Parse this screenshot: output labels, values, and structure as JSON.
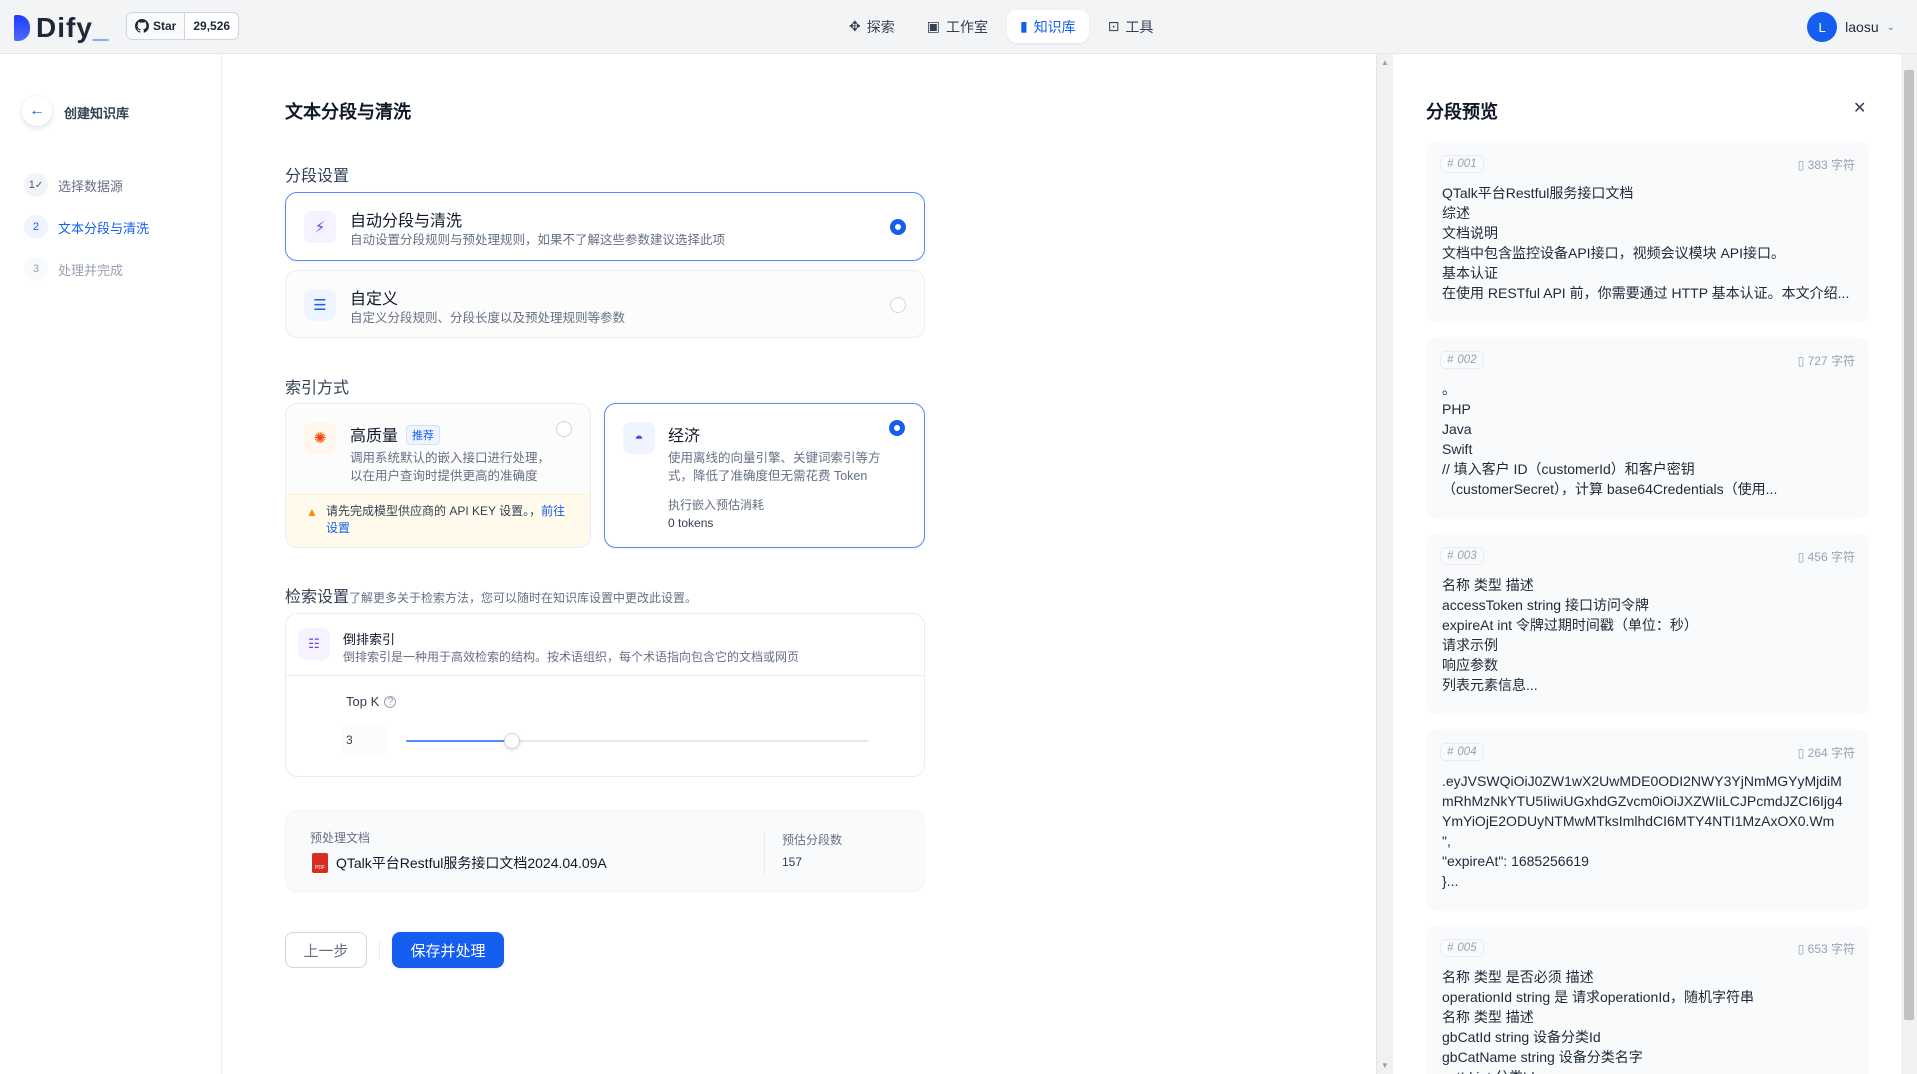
{
  "header": {
    "logo_text": "Dify",
    "github_star_label": "Star",
    "github_star_count": "29,526",
    "nav": [
      {
        "label": "探索",
        "icon": "explore-icon"
      },
      {
        "label": "工作室",
        "icon": "studio-icon"
      },
      {
        "label": "知识库",
        "icon": "knowledge-icon"
      },
      {
        "label": "工具",
        "icon": "tools-icon"
      }
    ],
    "active_nav": "知识库",
    "user": {
      "initial": "L",
      "name": "laosu"
    }
  },
  "sidebar": {
    "title": "创建知识库",
    "steps": [
      {
        "num": "1",
        "label": "选择数据源",
        "state": "done"
      },
      {
        "num": "2",
        "label": "文本分段与清洗",
        "state": "active"
      },
      {
        "num": "3",
        "label": "处理并完成",
        "state": "todo"
      }
    ]
  },
  "main": {
    "title": "文本分段与清洗",
    "segment_settings_label": "分段设置",
    "segment_modes": [
      {
        "title": "自动分段与清洗",
        "desc": "自动设置分段规则与预处理规则，如果不了解这些参数建议选择此项",
        "selected": true
      },
      {
        "title": "自定义",
        "desc": "自定义分段规则、分段长度以及预处理规则等参数",
        "selected": false
      }
    ],
    "index_label": "索引方式",
    "index_modes": {
      "high_quality": {
        "title": "高质量",
        "badge": "推荐",
        "desc_line1": "调用系统默认的嵌入接口进行处理，",
        "desc_line2": "以在用户查询时提供更高的准确度",
        "warning_text": "请先完成模型供应商的 API KEY 设置。",
        "warning_link_1": "前往",
        "warning_link_2": "设置",
        "selected": false
      },
      "economy": {
        "title": "经济",
        "desc_line1": "使用离线的向量引擎、关键词索引等方",
        "desc_line2": "式，降低了准确度但无需花费 Token",
        "cost_label": "执行嵌入预估消耗",
        "cost_value": "0 tokens",
        "selected": true
      }
    },
    "retrieval": {
      "title": "检索设置",
      "learn_more": "了解更多",
      "hint": "关于检索方法，您可以随时在知识库设置中更改此设置。",
      "method_title": "倒排索引",
      "method_desc": "倒排索引是一种用于高效检索的结构。按术语组织，每个术语指向包含它的文档或网页",
      "topk_label": "Top K",
      "topk_value": "3",
      "topk_fraction": 0.23
    },
    "summary": {
      "doc_label": "预处理文档",
      "doc_name": "QTalk平台Restful服务接口文档2024.04.09A",
      "seg_count_label": "预估分段数",
      "seg_count": "157"
    },
    "prev_button": "上一步",
    "save_button": "保存并处理"
  },
  "preview": {
    "title": "分段预览",
    "segments": [
      {
        "id": "001",
        "count": "383 字符",
        "lines": [
          "QTalk平台Restful服务接口文档",
          "综述",
          "文档说明",
          "文档中包含监控设备API接口，视频会议模块 API接口。",
          "基本认证",
          "在使用 RESTful API 前，你需要通过 HTTP 基本认证。本文介绍..."
        ]
      },
      {
        "id": "002",
        "count": "727 字符",
        "lines": [
          "。",
          "PHP",
          "Java",
          "Swift",
          "// 填入客户 ID（customerId）和客户密钥",
          "（customerSecret），计算 base64Credentials（使用..."
        ]
      },
      {
        "id": "003",
        "count": "456 字符",
        "lines": [
          "名称 类型 描述",
          "accessToken string 接口访问令牌",
          "expireAt int 令牌过期时间戳（单位：秒）",
          "请求示例",
          "响应参数",
          "列表元素信息..."
        ]
      },
      {
        "id": "004",
        "count": "264 字符",
        "lines": [
          ".eyJVSWQiOiJ0ZW1wX2UwMDE0ODI2NWY3YjNmMGYyMjdiM",
          "mRhMzNkYTU5IiwiUGxhdGZvcm0iOiJXZWIiLCJPcmdJZCI6Ijg4",
          "YmYiOjE2ODUyNTMwMTksImlhdCI6MTY4NTI1MzAxOX0.Wm",
          "\",",
          "\"expireAt\": 1685256619",
          "}..."
        ]
      },
      {
        "id": "005",
        "count": "653 字符",
        "lines": [
          "名称 类型 是否必须 描述",
          "operationId string 是 请求operationId，随机字符串",
          "名称 类型 描述",
          "gbCatId string 设备分类Id",
          "gbCatName string 设备分类名字",
          "catId int 分类Id"
        ]
      }
    ]
  }
}
